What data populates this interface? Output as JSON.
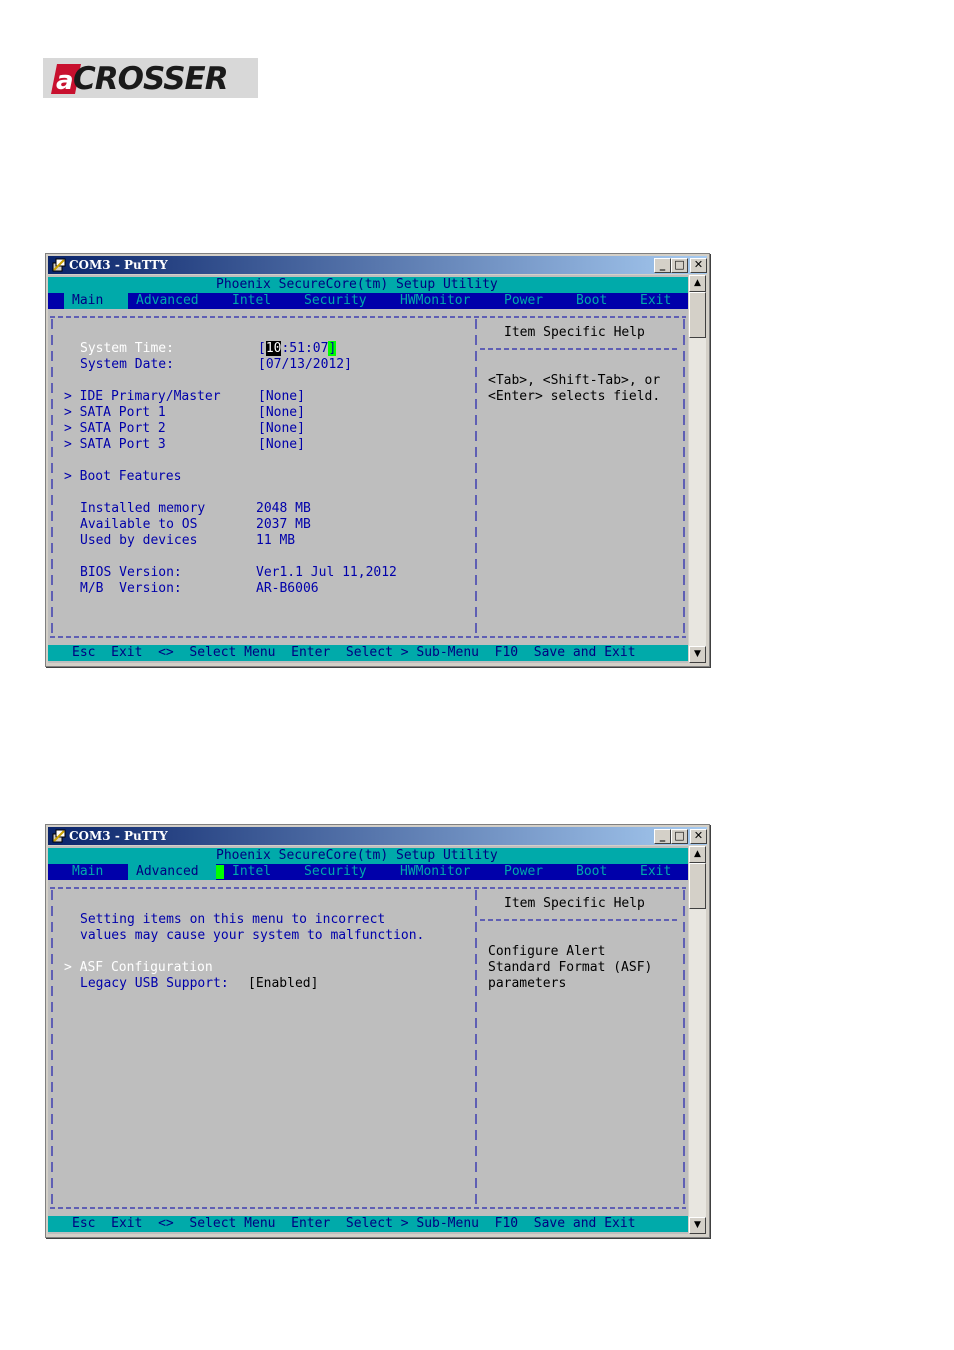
{
  "logo": {
    "text": "CROSSER",
    "mark": "a"
  },
  "windows": [
    {
      "title": "COM3 - PuTTY",
      "header": "Phoenix SecureCore(tm) Setup Utility",
      "tabs": [
        "Main",
        "Advanced",
        "Intel",
        "Security",
        "HWMonitor",
        "Power",
        "Boot",
        "Exit"
      ],
      "active_tab": "Main",
      "border_top": "+---------------------------------------------------------------------------------+",
      "items": {
        "system_time_label": "System Time:",
        "system_time_bracket_open": "[",
        "system_time_hour": "10",
        "system_time_rest": ":51:07",
        "system_time_bracket_close": "]",
        "system_date_label": "System Date:",
        "system_date_value": "[07/13/2012]",
        "ide_label": "> IDE Primary/Master",
        "ide_value": "[None]",
        "sata1_label": "> SATA Port 1",
        "sata1_value": "[None]",
        "sata2_label": "> SATA Port 2",
        "sata2_value": "[None]",
        "sata3_label": "> SATA Port 3",
        "sata3_value": "[None]",
        "boot_features_label": "> Boot Features",
        "installed_memory_label": "Installed memory",
        "installed_memory_value": "2048 MB",
        "available_label": "Available to OS",
        "available_value": "2037 MB",
        "used_label": "Used by devices",
        "used_value": "11 MB",
        "bios_label": "BIOS Version:",
        "bios_value": "Ver1.1 Jul 11,2012",
        "mb_label": "M/B  Version:",
        "mb_value": "AR-B6006"
      },
      "help": {
        "title": "Item Specific Help",
        "divider": "|------------------------|",
        "lines": [
          "<Tab>, <Shift-Tab>, or",
          "<Enter> selects field."
        ]
      },
      "footer": "Esc  Exit  <>  Select Menu  Enter  Select > Sub-Menu  F10  Save and Exit"
    },
    {
      "title": "COM3 - PuTTY",
      "header": "Phoenix SecureCore(tm) Setup Utility",
      "tabs": [
        "Main",
        "Advanced",
        "Intel",
        "Security",
        "HWMonitor",
        "Power",
        "Boot",
        "Exit"
      ],
      "active_tab": "Advanced",
      "items": {
        "warning_line1": "Setting items on this menu to incorrect",
        "warning_line2": "values may cause your system to malfunction.",
        "asf_label": "> ASF Configuration",
        "legacy_usb_label": "Legacy USB Support:",
        "legacy_usb_value": "[Enabled]"
      },
      "help": {
        "title": "Item Specific Help",
        "divider": "|------------------------|",
        "lines": [
          "Configure Alert",
          "Standard Format (ASF)",
          "parameters"
        ]
      },
      "footer": "Esc  Exit  <>  Select Menu  Enter  Select > Sub-Menu  F10  Save and Exit"
    }
  ],
  "colors": {
    "bios_background": "#bebebe",
    "bios_text": "#0000aa",
    "menu_bar": "#0000aa",
    "header_bar": "#00aaaa",
    "cursor_highlight": "#00ff00",
    "titlebar_start": "#0a246a",
    "titlebar_end": "#a6caf0"
  }
}
